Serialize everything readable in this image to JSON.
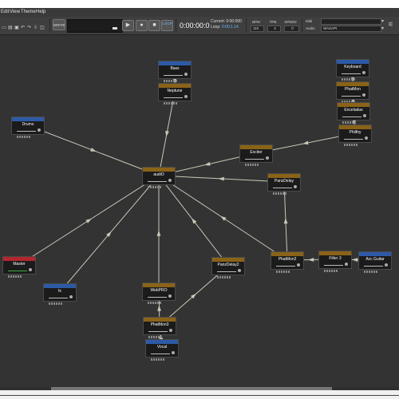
{
  "menu": [
    "Edit",
    "View",
    "Theme",
    "Help"
  ],
  "toolbar": {
    "write_label": "WRITE",
    "loop_label": "LOOP",
    "time_display": "0:00:00:0",
    "current_label": "Current: 0:00:000",
    "loop_prefix": "Loop: ",
    "loop_value": "0:00:1.14",
    "bpm_label": "BPM",
    "tpb_label": "TPB",
    "speed_label": "SPEED",
    "bpm_value": "110",
    "tpb_value": "4",
    "speed_value": "0",
    "midi_label": "Midi",
    "audio_label": "Audio",
    "audio_value": "WASAPI",
    "play_glyph": "▶",
    "record_glyph": "●",
    "stop_glyph": "■"
  },
  "nodes": [
    {
      "id": "bass",
      "label": "Bass",
      "color": "blue"
    },
    {
      "id": "keyboard",
      "label": "Keyboard",
      "color": "blue"
    },
    {
      "id": "neptune",
      "label": "Neptune",
      "color": "brown"
    },
    {
      "id": "phatmon",
      "label": "PhatMon",
      "color": "brown"
    },
    {
      "id": "drums",
      "label": "Drums",
      "color": "blue"
    },
    {
      "id": "enceladus",
      "label": "Enceladus",
      "color": "brown"
    },
    {
      "id": "philthy",
      "label": "Philthy",
      "color": "brown"
    },
    {
      "id": "exciter",
      "label": "Exciter",
      "color": "brown"
    },
    {
      "id": "mainout",
      "label": "audiO",
      "color": "brown"
    },
    {
      "id": "panzdelay",
      "label": "PanzDelay",
      "color": "brown"
    },
    {
      "id": "master",
      "label": "Master",
      "color": "red"
    },
    {
      "id": "fx",
      "label": "fx",
      "color": "blue"
    },
    {
      "id": "panzdelay2",
      "label": "PanzDelay2",
      "color": "brown"
    },
    {
      "id": "phatmon2",
      "label": "PhatMon2",
      "color": "brown"
    },
    {
      "id": "filter3",
      "label": "Filter 3",
      "color": "brown"
    },
    {
      "id": "accguitar",
      "label": "Acc Guitar",
      "color": "blue"
    },
    {
      "id": "webpro",
      "label": "WebPRO",
      "color": "brown"
    },
    {
      "id": "phatmon3",
      "label": "PhatMon3",
      "color": "brown"
    },
    {
      "id": "vocal",
      "label": "Vocal",
      "color": "blue"
    }
  ],
  "colors": {
    "blue": "#2d5aa6",
    "brown": "#8a6318",
    "red": "#b3262b",
    "link": "#c8c8b8"
  }
}
